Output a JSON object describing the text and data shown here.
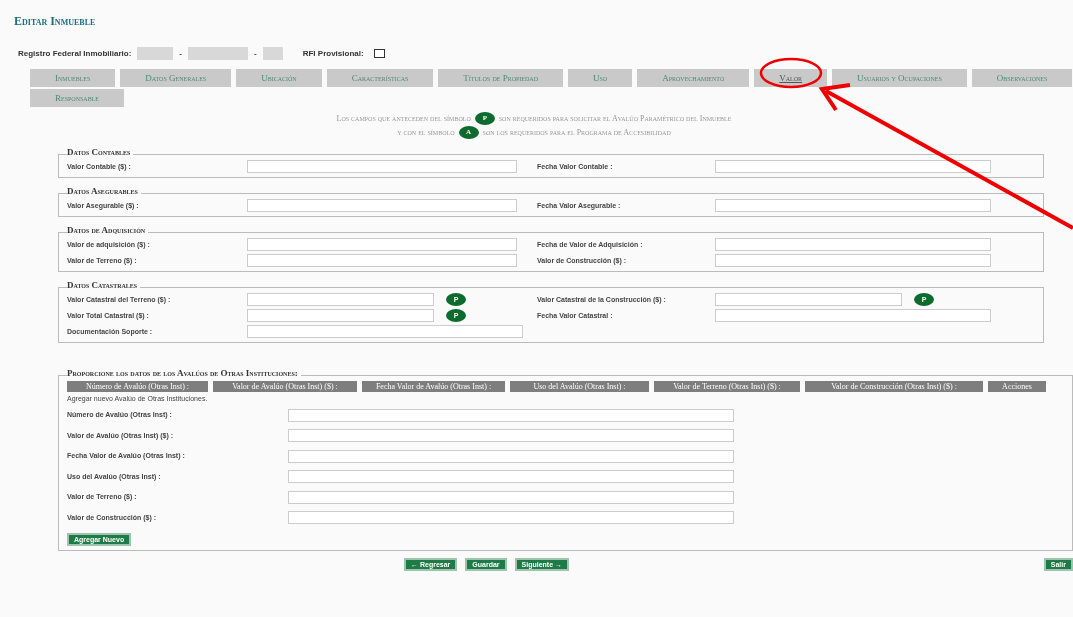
{
  "title": "Editar Inmueble",
  "rfi": {
    "label": "Registro Federal Inmobiliario:",
    "separator": "-",
    "provisional_label": "RFI Provisional:",
    "provisional_checked": false
  },
  "tabs": [
    {
      "label": "Inmuebles",
      "selected": false
    },
    {
      "label": "Datos Generales",
      "selected": false
    },
    {
      "label": "Ubicación",
      "selected": false
    },
    {
      "label": "Características",
      "selected": false
    },
    {
      "label": "Títulos de Propiedad",
      "selected": false
    },
    {
      "label": "Uso",
      "selected": false
    },
    {
      "label": "Aprovechamiento",
      "selected": false
    },
    {
      "label": "Valor",
      "selected": true
    },
    {
      "label": "Usuarios y Ocupaciones",
      "selected": false
    },
    {
      "label": "Observaciones",
      "selected": false
    },
    {
      "label": "Responsable",
      "selected": false
    }
  ],
  "notes": [
    {
      "before": "Los campos que anteceden del símbolo",
      "badge": "P",
      "after": "son requeridos para solicitar el Avalúo Paramétrico del Inmueble"
    },
    {
      "before": "y con el símbolo",
      "badge": "A",
      "after": "son los requeridos para el Programa de Accesibilidad"
    }
  ],
  "sections": [
    {
      "title": "Datos Contables",
      "fields": [
        {
          "label": "Valor Contable ($) :"
        },
        {
          "label": "Fecha Valor Contable :"
        }
      ]
    },
    {
      "title": "Datos Asegurables",
      "fields": [
        {
          "label": "Valor Asegurable ($) :"
        },
        {
          "label": "Fecha Valor Asegurable :"
        }
      ]
    },
    {
      "title": "Datos de Adquisición",
      "fields": [
        {
          "label": "Valor de adquisición ($) :"
        },
        {
          "label": "Fecha de Valor de Adquisición :"
        },
        {
          "label": "Valor de Terreno ($) :"
        },
        {
          "label": "Valor de Construcción ($) :"
        }
      ]
    },
    {
      "title": "Datos Catastrales",
      "fields": [
        {
          "label": "Valor Catastral del Terreno ($) :",
          "badge": "P"
        },
        {
          "label": "Valor Catastral de la Construcción ($) :",
          "badge": "P"
        },
        {
          "label": "Valor Total Catastral ($) :",
          "badge": "P"
        },
        {
          "label": "Fecha Valor Catastral :"
        },
        {
          "label": "Documentación Soporte :"
        }
      ]
    }
  ],
  "avaluos": {
    "title": "Proporcione los datos de los Avalúos de Otras Instituciones:",
    "columns": [
      "Número de Avalúo (Otras Inst) :",
      "Valor de Avalúo (Otras Inst) ($) :",
      "Fecha Valor de Avalúo (Otras Inst) :",
      "Uso del Avalúo (Otras Inst) :",
      "Valor de Terreno (Otras Inst) ($) :",
      "Valor de Construcción (Otras Inst) ($) :",
      "Acciones"
    ],
    "add_caption": "Agregar nuevo Avalúo de Otras Instituciones.",
    "fields": [
      "Número de Avalúo (Otras Inst) :",
      "Valor de Avalúo (Otras Inst) ($) :",
      "Fecha Valor de Avalúo (Otras Inst) :",
      "Uso del Avalúo (Otras Inst) :",
      "Valor de Terreno ($) :",
      "Valor de Construcción ($) :"
    ],
    "add_button": "Agregar Nuevo"
  },
  "buttons": [
    {
      "label": "← Regresar",
      "kind": "nav"
    },
    {
      "label": "Guardar",
      "kind": "nav"
    },
    {
      "label": "Siguiente →",
      "kind": "nav"
    },
    {
      "label": "Salir",
      "kind": "exit"
    }
  ]
}
